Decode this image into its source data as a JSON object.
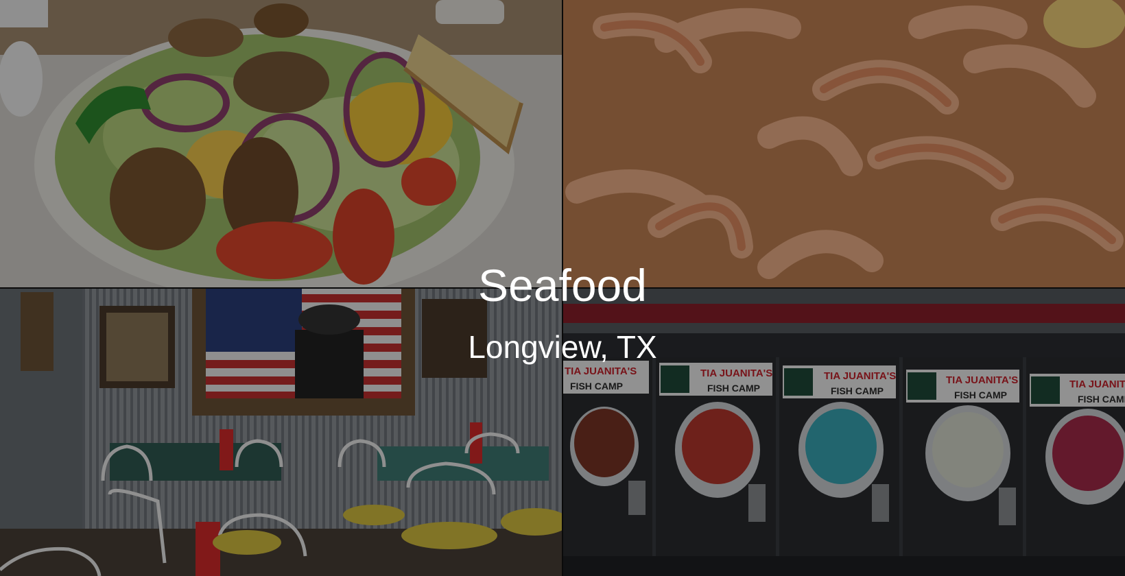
{
  "hero": {
    "title": "Seafood",
    "subtitle": "Longview, TX"
  },
  "photos": [
    {
      "subject": "grilled shrimp salad"
    },
    {
      "subject": "seasoned boiled shrimp"
    },
    {
      "subject": "restaurant dining room"
    },
    {
      "subject": "frozen drink machines"
    }
  ],
  "machine_signs": {
    "line1": "TIA JUANITA'S",
    "line2": "FISH CAMP"
  },
  "colors": {
    "overlay": "#000000",
    "text": "#ffffff"
  }
}
